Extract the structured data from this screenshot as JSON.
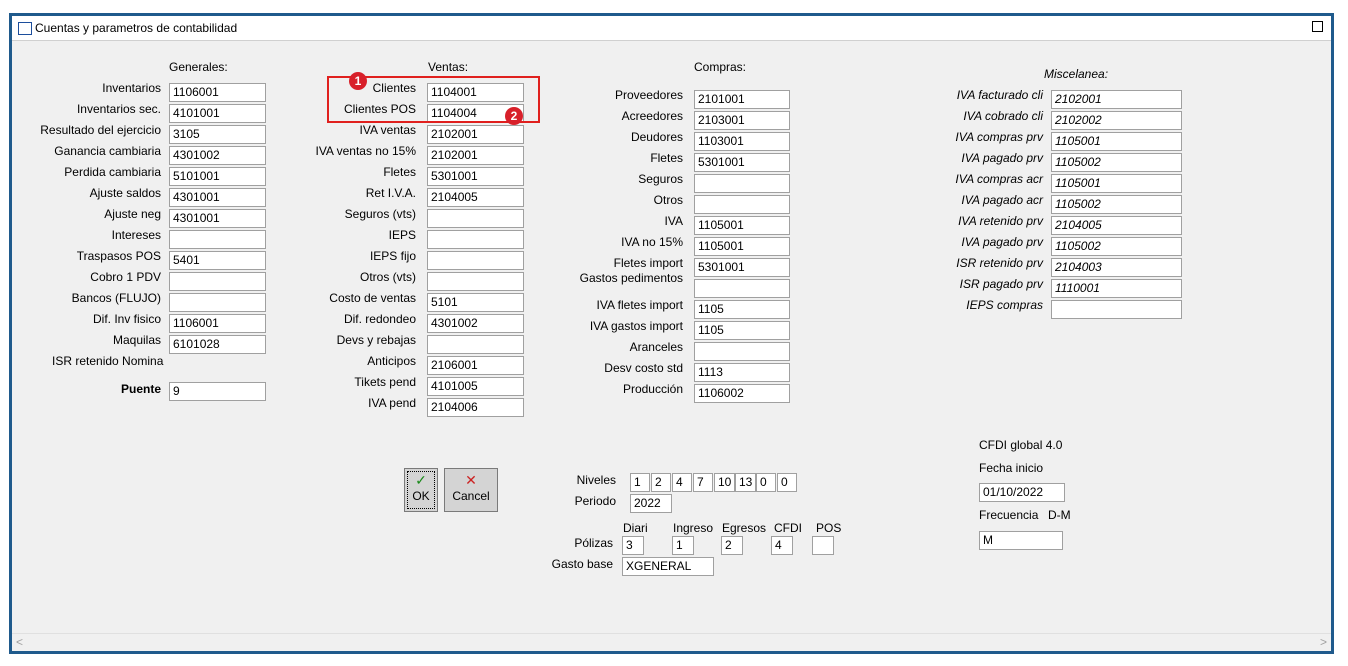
{
  "window": {
    "title": "Cuentas y parametros de contabilidad"
  },
  "generales": {
    "header": "Generales:",
    "rows": [
      {
        "label": "Inventarios",
        "value": "1106001"
      },
      {
        "label": "Inventarios sec.",
        "value": "4101001"
      },
      {
        "label": "Resultado del ejercicio",
        "value": "3105"
      },
      {
        "label": "Ganancia cambiaria",
        "value": "4301002"
      },
      {
        "label": "Perdida cambiaria",
        "value": "5101001"
      },
      {
        "label": "Ajuste saldos",
        "value": "4301001"
      },
      {
        "label": "Ajuste neg",
        "value": "4301001"
      },
      {
        "label": "Intereses",
        "value": ""
      },
      {
        "label": "Traspasos POS",
        "value": "5401"
      },
      {
        "label": "Cobro 1 PDV",
        "value": ""
      },
      {
        "label": "Bancos (FLUJO)",
        "value": ""
      },
      {
        "label": "Dif. Inv fisico",
        "value": "1106001"
      },
      {
        "label": "Maquilas",
        "value": "6101028"
      }
    ],
    "isr_nomina_label": "ISR retenido Nomina",
    "puente_label": "Puente",
    "puente_value": "9"
  },
  "ventas": {
    "header": "Ventas:",
    "rows": [
      {
        "label": "Clientes",
        "value": "1104001"
      },
      {
        "label": "Clientes POS",
        "value": "1104004"
      },
      {
        "label": "IVA ventas",
        "value": "2102001"
      },
      {
        "label": "IVA ventas no 15%",
        "value": "2102001"
      },
      {
        "label": "Fletes",
        "value": "5301001"
      },
      {
        "label": "Ret I.V.A.",
        "value": "2104005"
      },
      {
        "label": "Seguros (vts)",
        "value": ""
      },
      {
        "label": "IEPS",
        "value": ""
      },
      {
        "label": "IEPS fijo",
        "value": ""
      },
      {
        "label": "Otros (vts)",
        "value": ""
      },
      {
        "label": "Costo de ventas",
        "value": "5101"
      },
      {
        "label": "Dif. redondeo",
        "value": "4301002"
      },
      {
        "label": "Devs y rebajas",
        "value": ""
      },
      {
        "label": "Anticipos",
        "value": "2106001"
      },
      {
        "label": "Tikets pend",
        "value": "4101005"
      },
      {
        "label": "IVA pend",
        "value": "2104006"
      }
    ]
  },
  "compras": {
    "header": "Compras:",
    "rows": [
      {
        "label": "Proveedores",
        "value": "2101001"
      },
      {
        "label": "Acreedores",
        "value": "2103001"
      },
      {
        "label": "Deudores",
        "value": "1103001"
      },
      {
        "label": "Fletes",
        "value": "5301001"
      },
      {
        "label": "Seguros",
        "value": ""
      },
      {
        "label": "Otros",
        "value": ""
      },
      {
        "label": "IVA",
        "value": "1105001"
      },
      {
        "label": "IVA  no 15%",
        "value": "1105001"
      },
      {
        "label": "Fletes import",
        "value": "5301001"
      },
      {
        "label": "Gastos pedimentos",
        "value": ""
      },
      {
        "label": "IVA fletes import",
        "value": "1105"
      },
      {
        "label": "IVA gastos import",
        "value": "1105"
      },
      {
        "label": "Aranceles",
        "value": ""
      },
      {
        "label": "Desv costo std",
        "value": "1113"
      },
      {
        "label": "Producción",
        "value": "1106002"
      }
    ]
  },
  "miscelanea": {
    "header": "Miscelanea:",
    "rows": [
      {
        "label": "IVA facturado cli",
        "value": "2102001"
      },
      {
        "label": "IVA cobrado cli",
        "value": "2102002"
      },
      {
        "label": "IVA compras prv",
        "value": "1105001"
      },
      {
        "label": "IVA pagado prv",
        "value": "1105002"
      },
      {
        "label": "IVA compras acr",
        "value": "1105001"
      },
      {
        "label": "IVA pagado acr",
        "value": "1105002"
      },
      {
        "label": "IVA retenido prv",
        "value": "2104005"
      },
      {
        "label": "IVA pagado prv",
        "value": "1105002"
      },
      {
        "label": "ISR retenido prv",
        "value": "2104003"
      },
      {
        "label": "ISR pagado prv",
        "value": "1110001"
      },
      {
        "label": "IEPS compras",
        "value": ""
      }
    ]
  },
  "buttons": {
    "ok_label": "OK",
    "ok_icon": "✓",
    "cancel_label": "Cancel",
    "cancel_icon": "✕"
  },
  "niveles": {
    "label": "Niveles",
    "values": [
      "1",
      "2",
      "4",
      "7",
      "10",
      "13",
      "0",
      "0"
    ]
  },
  "periodo": {
    "label": "Periodo",
    "value": "2022"
  },
  "polizas": {
    "label": "Pólizas",
    "columns": [
      {
        "header": "Diari",
        "value": "3"
      },
      {
        "header": "Ingreso",
        "value": "1"
      },
      {
        "header": "Egresos",
        "value": "2"
      },
      {
        "header": "CFDI",
        "value": "4"
      },
      {
        "header": "POS",
        "value": ""
      }
    ]
  },
  "gasto_base": {
    "label": "Gasto base",
    "value": "XGENERAL"
  },
  "cfdi": {
    "title": "CFDI global 4.0",
    "fecha_label": "Fecha inicio",
    "fecha_value": "01/10/2022",
    "frecuencia_label": "Frecuencia",
    "frecuencia_hint": "D-M",
    "frecuencia_value": "M"
  },
  "annotations": {
    "badge1": "1",
    "badge2": "2"
  },
  "colors": {
    "window_border": "#1f5a8c",
    "callout": "#e0201e",
    "ok_icon": "#1a8a1a",
    "cancel_icon": "#cc2222"
  }
}
